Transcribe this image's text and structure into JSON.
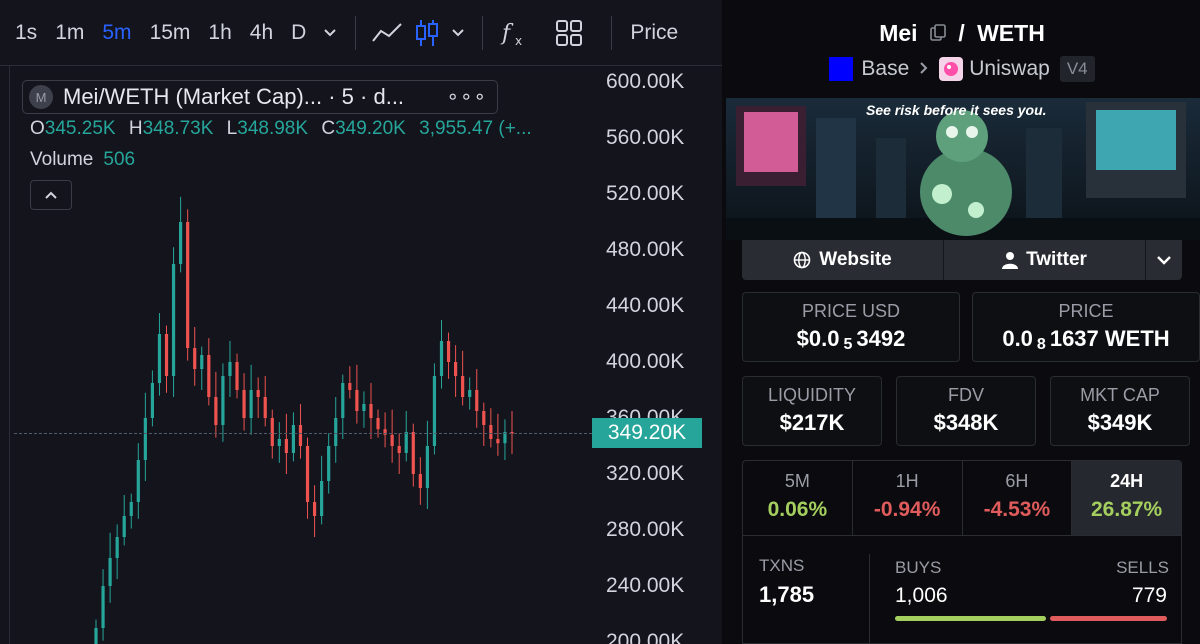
{
  "toolbar": {
    "timeframes": [
      "1s",
      "1m",
      "5m",
      "15m",
      "1h",
      "4h",
      "D"
    ],
    "active_timeframe": "5m",
    "price_label": "Price"
  },
  "legend": {
    "logo_letter": "M",
    "title": "Mei/WETH (Market Cap)... · 5 · d...",
    "more": "∘∘∘",
    "ohlc": {
      "O": "345.25K",
      "H": "348.73K",
      "L": "348.98K",
      "C": "349.20K",
      "change": "3,955.47 (+..."
    },
    "volume_label": "Volume",
    "volume_value": "506"
  },
  "chart_data": {
    "type": "candlestick",
    "title": "Mei/WETH (Market Cap)",
    "interval": "5m",
    "y_ticks": [
      "600.00K",
      "560.00K",
      "520.00K",
      "480.00K",
      "440.00K",
      "400.00K",
      "360.00K",
      "320.00K",
      "280.00K",
      "240.00K",
      "200.00K"
    ],
    "ylim": [
      200000,
      600000
    ],
    "last_price_label": "349.20K",
    "last_price": 349200,
    "approx_close_path": [
      210000,
      240000,
      260000,
      275000,
      290000,
      300000,
      330000,
      360000,
      385000,
      420000,
      390000,
      470000,
      500000,
      410000,
      395000,
      405000,
      375000,
      355000,
      390000,
      400000,
      380000,
      360000,
      380000,
      375000,
      360000,
      340000,
      345000,
      335000,
      355000,
      340000,
      300000,
      290000,
      315000,
      340000,
      360000,
      385000,
      380000,
      365000,
      370000,
      360000,
      352000,
      348000,
      340000,
      335000,
      350000,
      320000,
      310000,
      340000,
      390000,
      415000,
      400000,
      390000,
      375000,
      380000,
      365000,
      355000,
      345000,
      342000,
      350000,
      349200
    ],
    "up_color": "#26a69a",
    "down_color": "#ef5350"
  },
  "pair": {
    "base": "Mei",
    "quote": "WETH",
    "separator": "/",
    "chain": "Base",
    "dex": "Uniswap",
    "version": "V4"
  },
  "banner": {
    "caption": "See risk before it sees you."
  },
  "social": {
    "website": "Website",
    "twitter": "Twitter"
  },
  "stats": {
    "price_usd_label": "PRICE USD",
    "price_usd_prefix": "$0.0",
    "price_usd_sub": "5",
    "price_usd_digits": "3492",
    "price_label": "PRICE",
    "price_prefix": "0.0",
    "price_sub": "8",
    "price_digits": "1637 WETH",
    "liquidity_label": "LIQUIDITY",
    "liquidity_value": "$217K",
    "fdv_label": "FDV",
    "fdv_value": "$348K",
    "mktcap_label": "MKT CAP",
    "mktcap_value": "$349K"
  },
  "changes": [
    {
      "label": "5M",
      "value": "0.06%",
      "sign": "pos"
    },
    {
      "label": "1H",
      "value": "-0.94%",
      "sign": "neg"
    },
    {
      "label": "6H",
      "value": "-4.53%",
      "sign": "neg"
    },
    {
      "label": "24H",
      "value": "26.87%",
      "sign": "pos"
    }
  ],
  "active_change": "24H",
  "txns": {
    "txns_label": "TXNS",
    "txns_value": "1,785",
    "buys_label": "BUYS",
    "buys_value": "1,006",
    "sells_label": "SELLS",
    "sells_value": "779",
    "buy_ratio": 0.5636
  },
  "colors": {
    "accent": "#2962ff",
    "positive": "#a4cf5e",
    "negative": "#e05c5c",
    "chain": "#0000ff"
  }
}
